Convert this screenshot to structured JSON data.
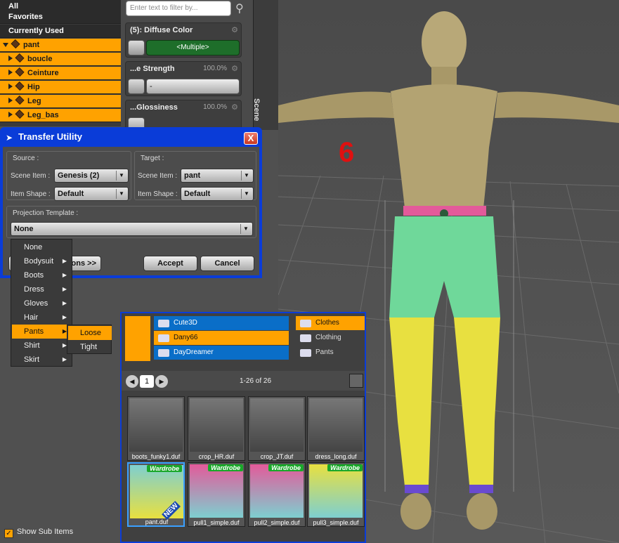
{
  "scene_tree": {
    "rows": [
      {
        "label": "All",
        "style": "dark"
      },
      {
        "label": "Favorites",
        "style": "dark"
      },
      {
        "label": "Currently Used",
        "style": "dark"
      },
      {
        "label": "pant",
        "style": "sel"
      },
      {
        "label": "boucle",
        "style": "sel"
      },
      {
        "label": "Ceinture",
        "style": "sel"
      },
      {
        "label": "Hip",
        "style": "sel"
      },
      {
        "label": "Leg",
        "style": "sel"
      },
      {
        "label": "Leg_bas",
        "style": "sel"
      }
    ]
  },
  "surfaces": {
    "filter_placeholder": "Enter text to filter by...",
    "props": [
      {
        "title": "(5): Diffuse Color",
        "value": "",
        "control": "<Multiple>"
      },
      {
        "title": "...e Strength",
        "value": "100.0%",
        "control": "-"
      },
      {
        "title": "...Glossiness",
        "value": "100.0%",
        "control": "-"
      }
    ],
    "side_tab": "Scene"
  },
  "dialog": {
    "title": "Transfer Utility",
    "close": "X",
    "source_label": "Source :",
    "target_label": "Target :",
    "scene_item_label": "Scene Item :",
    "item_shape_label": "Item Shape :",
    "source_scene_item": "Genesis (2)",
    "source_item_shape": "Default",
    "target_scene_item": "pant",
    "target_item_shape": "Default",
    "projection_label": "Projection Template :",
    "projection_value": "None",
    "options_btn": "...ons >>",
    "accept": "Accept",
    "cancel": "Cancel"
  },
  "menu": {
    "items": [
      {
        "label": "None",
        "sub": false
      },
      {
        "label": "Bodysuit",
        "sub": true
      },
      {
        "label": "Boots",
        "sub": true
      },
      {
        "label": "Dress",
        "sub": true
      },
      {
        "label": "Gloves",
        "sub": true
      },
      {
        "label": "Hair",
        "sub": true
      },
      {
        "label": "Pants",
        "sub": true
      },
      {
        "label": "Shirt",
        "sub": true
      },
      {
        "label": "Skirt",
        "sub": true
      }
    ],
    "selected": "Pants",
    "submenu": [
      "Loose",
      "Tight"
    ],
    "submenu_selected": "Loose"
  },
  "library": {
    "folders_left": [
      {
        "label": "Cute3D",
        "style": "blue"
      },
      {
        "label": "Dany66",
        "style": "orange"
      },
      {
        "label": "DayDreamer",
        "style": "blue"
      }
    ],
    "folders_right": [
      {
        "label": "Clothes",
        "style": "orange"
      },
      {
        "label": "Clothing",
        "style": "gray"
      },
      {
        "label": "Pants",
        "style": "gray"
      }
    ],
    "page": "1",
    "range": "1-26 of 26",
    "thumbs": [
      {
        "name": "boots_funky1.duf",
        "badge": ""
      },
      {
        "name": "crop_HR.duf",
        "badge": ""
      },
      {
        "name": "crop_JT.duf",
        "badge": ""
      },
      {
        "name": "dress_long.duf",
        "badge": ""
      },
      {
        "name": "pant.duf",
        "badge": "Wardrobe",
        "new": "NEW"
      },
      {
        "name": "pull1_simple.duf",
        "badge": "Wardrobe"
      },
      {
        "name": "pull2_simple.duf",
        "badge": "Wardrobe"
      },
      {
        "name": "pull3_simple.duf",
        "badge": "Wardrobe"
      }
    ]
  },
  "show_sub_items": {
    "label": "Show Sub Items",
    "checked": true
  },
  "viewport": {
    "annotation": "6",
    "annotation_color": "#e01010"
  }
}
